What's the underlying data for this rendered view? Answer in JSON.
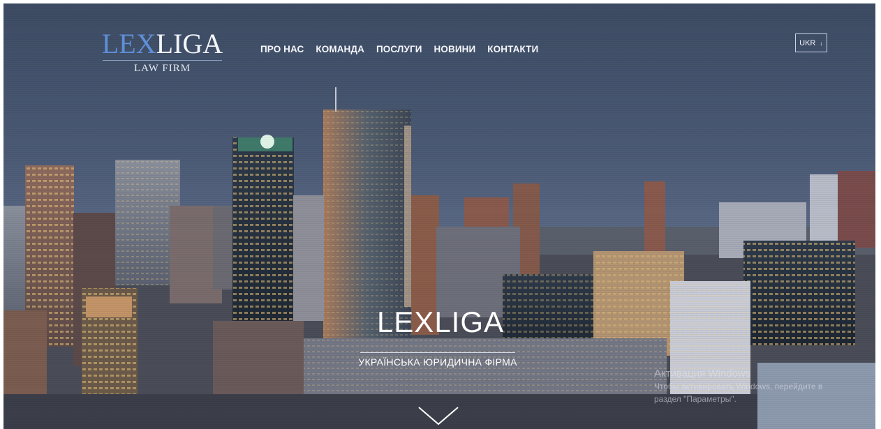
{
  "brand": {
    "lex": "LEX",
    "liga": "LIGA",
    "subtitle": "LAW FIRM"
  },
  "nav": {
    "items": [
      "ПРО НАС",
      "КОМАНДА",
      "ПОСЛУГИ",
      "НОВИНИ",
      "КОНТАКТИ"
    ]
  },
  "language": {
    "selected": "UKR",
    "arrow": "↓"
  },
  "hero": {
    "title": "LEXLIGA",
    "subtitle": "УКРАЇНСЬКА ЮРИДИЧНА ФІРМА",
    "scroll_icon": "chevron-down-icon"
  },
  "watermark": {
    "title": "Активация Windows",
    "line1": "Чтобы активировать Windows, перейдите в",
    "line2": "раздел \"Параметры\"."
  },
  "colors": {
    "accent": "#5f8fd8",
    "sky": "#4b5a75"
  }
}
